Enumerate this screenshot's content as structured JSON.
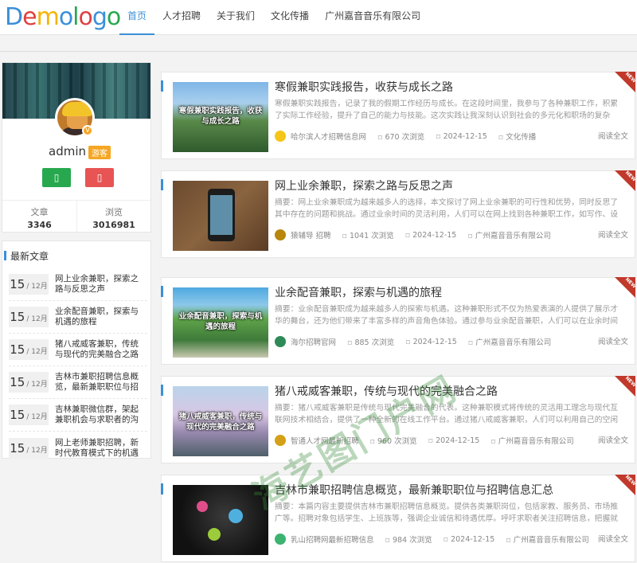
{
  "header": {
    "logo": {
      "parts": [
        "D",
        "e",
        "m",
        "o",
        "l",
        "o",
        "g",
        "o"
      ]
    },
    "nav": [
      {
        "label": "首页",
        "active": true
      },
      {
        "label": "人才招聘"
      },
      {
        "label": "关于我们"
      },
      {
        "label": "文化传播"
      },
      {
        "label": "广州嘉音音乐有限公司"
      }
    ]
  },
  "profile": {
    "username": "admin",
    "badge": "游客",
    "v_badge": "V",
    "stats": [
      {
        "label": "文章",
        "value": "3346"
      },
      {
        "label": "浏览",
        "value": "3016981"
      }
    ]
  },
  "latest": {
    "title": "最新文章",
    "items": [
      {
        "day": "15",
        "month": "/ 12月",
        "title": "网上业余兼职，探索之路与反思之声"
      },
      {
        "day": "15",
        "month": "/ 12月",
        "title": "业余配音兼职，探索与机遇的旅程"
      },
      {
        "day": "15",
        "month": "/ 12月",
        "title": "猪八戒威客兼职，传统与现代的完美融合之路"
      },
      {
        "day": "15",
        "month": "/ 12月",
        "title": "吉林市兼职招聘信息概览，最新兼职职位与招聘"
      },
      {
        "day": "15",
        "month": "/ 12月",
        "title": "吉林兼职微信群，架起兼职机会与求职者的沟通桥"
      },
      {
        "day": "15",
        "month": "/ 12月",
        "title": "网上老师兼职招聘，新时代教育模式下的机遇与挑"
      }
    ]
  },
  "articles": [
    {
      "title": "寒假兼职实践报告，收获与成长之路",
      "thumb_caption": "寒假兼职实践报告，收获与成长之路",
      "desc": "寒假兼职实践报告，记录了我的假期工作经历与成长。在这段时间里，我参与了各种兼职工作，积累了实际工作经验，提升了自己的能力与技能。这次实践让我深刻认识到社会的多元化和职场的复杂性，同时也让我...",
      "author": "哈尔滨人才招聘信息网",
      "views": "670 次浏览",
      "date": "2024-12-15",
      "category": "文化传播",
      "read": "阅读全文",
      "ribbon": "NEW"
    },
    {
      "title": "网上业余兼职，探索之路与反思之声",
      "thumb_caption": "",
      "desc": "摘要：网上业余兼职成为越来越多人的选择，本文探讨了网上业余兼职的可行性和优势，同时反思了其中存在的问题和挑战。通过业余时间的灵活利用，人们可以在网上找到各种兼职工作，如写作、设计、翻译等。",
      "author": "猿辅导 招聘",
      "views": "1041 次浏览",
      "date": "2024-12-15",
      "category": "广州嘉音音乐有限公司",
      "read": "阅读全文",
      "ribbon": "NEW"
    },
    {
      "title": "业余配音兼职，探索与机遇的旅程",
      "thumb_caption": "业余配音兼职，探索与机遇的旅程",
      "desc": "摘要：业余配音兼职成为越来越多人的探索与机遇。这种兼职形式不仅为热爱表演的人提供了展示才华的舞台，还为他们带来了丰富多样的声音角色体验。通过参与业余配音兼职，人们可以在业余时间发挥创造力，...",
      "author": "海尔招聘官网",
      "views": "885 次浏览",
      "date": "2024-12-15",
      "category": "广州嘉音音乐有限公司",
      "read": "阅读全文",
      "ribbon": "NEW"
    },
    {
      "title": "猪八戒威客兼职，传统与现代的完美融合之路",
      "thumb_caption": "猪八戒威客兼职，传统与现代的完美融合之路",
      "desc": "摘要：猪八戒威客兼职是传统与现代完美融合的代表。这种兼职模式将传统的灵活用工理念与现代互联网技术相结合，提供了一种全新的在线工作平台。通过猪八戒威客兼职，人们可以利用自己的空闲时间，凭...",
      "author": "智通人才网最新招聘",
      "views": "960 次浏览",
      "date": "2024-12-15",
      "category": "广州嘉音音乐有限公司",
      "read": "阅读全文",
      "ribbon": "NEW"
    },
    {
      "title": "吉林市兼职招聘信息概览，最新兼职职位与招聘信息汇总",
      "thumb_caption": "",
      "desc": "摘要：本篇内容主要提供吉林市兼职招聘信息概览。提供各类兼职岗位，包括家教、服务员、市场推广等。招聘对象包括学生、上班族等，强调企业诚信和待遇优厚。呼吁求职者关注招聘信息，把握就业机会。具体...",
      "author": "乳山招聘网最新招聘信息",
      "views": "984 次浏览",
      "date": "2024-12-15",
      "category": "广州嘉音音乐有限公司",
      "read": "阅读全文",
      "ribbon": "NEW"
    }
  ],
  "watermark": "海艺图门户网"
}
